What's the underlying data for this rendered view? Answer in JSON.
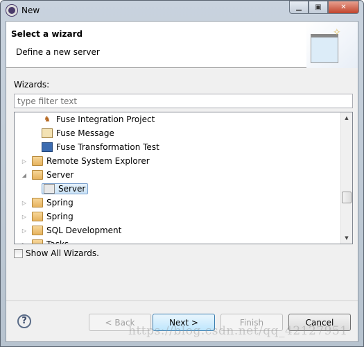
{
  "window": {
    "title": "New",
    "icon": "eclipse-gear-icon"
  },
  "header": {
    "title": "Select a wizard",
    "description": "Define a new server"
  },
  "wizards": {
    "label": "Wizards:",
    "filter_placeholder": "type filter text",
    "filter_value": "",
    "items": [
      {
        "label": "Fuse Integration Project",
        "icon": "camel-icon",
        "level": 1
      },
      {
        "label": "Fuse Message",
        "icon": "message-icon",
        "level": 1
      },
      {
        "label": "Fuse Transformation Test",
        "icon": "test-icon",
        "level": 1
      },
      {
        "label": "Remote System Explorer",
        "icon": "folder-icon",
        "level": 0,
        "expanded": false
      },
      {
        "label": "Server",
        "icon": "folder-icon",
        "level": 0,
        "expanded": true
      },
      {
        "label": "Server",
        "icon": "server-wizard-icon",
        "level": 1,
        "selected": true
      },
      {
        "label": "Spring",
        "icon": "folder-icon",
        "level": 0,
        "expanded": false
      },
      {
        "label": "Spring",
        "icon": "folder-icon",
        "level": 0,
        "expanded": false
      },
      {
        "label": "SQL Development",
        "icon": "folder-icon",
        "level": 0,
        "expanded": false
      },
      {
        "label": "Tasks",
        "icon": "folder-icon",
        "level": 0,
        "expanded": false
      }
    ]
  },
  "show_all": {
    "label": "Show All Wizards.",
    "checked": false
  },
  "buttons": {
    "back": "< Back",
    "next": "Next >",
    "finish": "Finish",
    "cancel": "Cancel"
  },
  "watermark": "https://blog.csdn.net/qq_42127951"
}
